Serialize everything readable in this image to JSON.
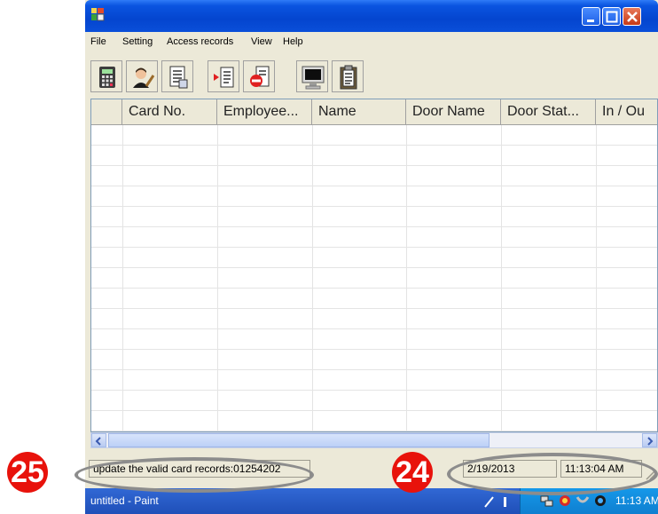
{
  "menu": [
    "File",
    "Setting",
    "Access records",
    "View",
    "Help"
  ],
  "toolbar": {
    "buttons": [
      "calculator-icon",
      "user-edit-icon",
      "document-list-icon",
      "import-records-icon",
      "delete-records-icon",
      "monitor-icon",
      "clipboard-icon"
    ]
  },
  "grid": {
    "columns": [
      "",
      "Card No.",
      "Employee...",
      "Name",
      "Door Name",
      "Door Stat...",
      "In / Ou"
    ]
  },
  "status": {
    "message": "update the valid card records:01254202",
    "date": "2/19/2013",
    "time": "11:13:04 AM"
  },
  "taskbar": {
    "task_label": "untitled - Paint",
    "clock": "11:13 AM"
  },
  "callouts": {
    "left": "25",
    "right": "24"
  },
  "colors": {
    "titlebar": "#0a54e0",
    "callout": "#e8120b",
    "taskbar": "#1f4fb8"
  }
}
